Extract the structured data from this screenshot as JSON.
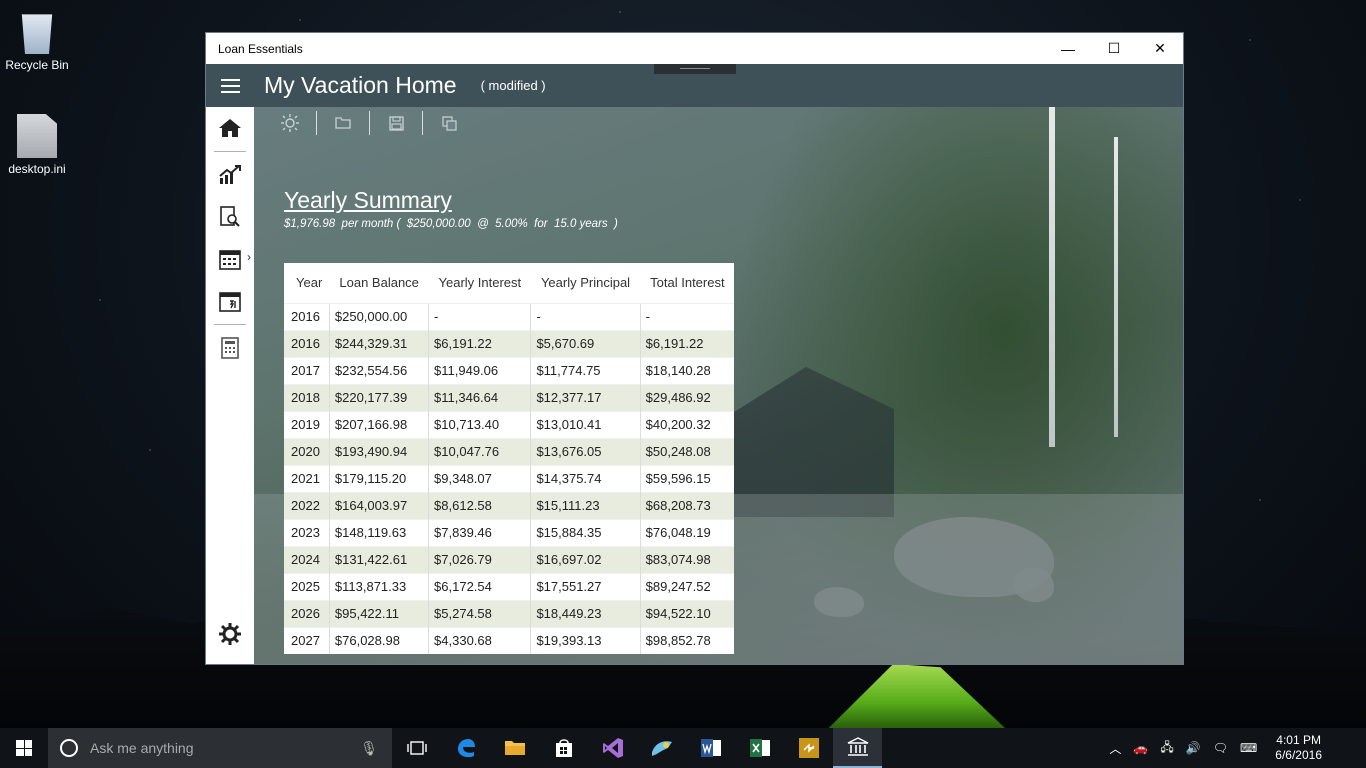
{
  "desktop": {
    "icons": [
      {
        "label": "Recycle Bin"
      },
      {
        "label": "desktop.ini"
      }
    ]
  },
  "window": {
    "title": "Loan Essentials",
    "controls": {
      "minimize": "—",
      "maximize": "☐",
      "close": "✕"
    }
  },
  "header": {
    "doc_title": "My Vacation Home",
    "modified": "( modified )"
  },
  "summary": {
    "title": "Yearly Summary",
    "subtitle": "$1,976.98  per month (  $250,000.00  @  5.00%  for  15.0 years  )"
  },
  "table": {
    "headers": [
      "Year",
      "Loan Balance",
      "Yearly Interest",
      "Yearly Principal",
      "Total Interest"
    ],
    "rows": [
      [
        "2016",
        "$250,000.00",
        "-",
        "-",
        "-"
      ],
      [
        "2016",
        "$244,329.31",
        "$6,191.22",
        "$5,670.69",
        "$6,191.22"
      ],
      [
        "2017",
        "$232,554.56",
        "$11,949.06",
        "$11,774.75",
        "$18,140.28"
      ],
      [
        "2018",
        "$220,177.39",
        "$11,346.64",
        "$12,377.17",
        "$29,486.92"
      ],
      [
        "2019",
        "$207,166.98",
        "$10,713.40",
        "$13,010.41",
        "$40,200.32"
      ],
      [
        "2020",
        "$193,490.94",
        "$10,047.76",
        "$13,676.05",
        "$50,248.08"
      ],
      [
        "2021",
        "$179,115.20",
        "$9,348.07",
        "$14,375.74",
        "$59,596.15"
      ],
      [
        "2022",
        "$164,003.97",
        "$8,612.58",
        "$15,111.23",
        "$68,208.73"
      ],
      [
        "2023",
        "$148,119.63",
        "$7,839.46",
        "$15,884.35",
        "$76,048.19"
      ],
      [
        "2024",
        "$131,422.61",
        "$7,026.79",
        "$16,697.02",
        "$83,074.98"
      ],
      [
        "2025",
        "$113,871.33",
        "$6,172.54",
        "$17,551.27",
        "$89,247.52"
      ],
      [
        "2026",
        "$95,422.11",
        "$5,274.58",
        "$18,449.23",
        "$94,522.10"
      ],
      [
        "2027",
        "$76,028.98",
        "$4,330.68",
        "$19,393.13",
        "$98,852.78"
      ]
    ]
  },
  "taskbar": {
    "search_placeholder": "Ask me anything",
    "time": "4:01 PM",
    "date": "6/6/2016"
  },
  "colors": {
    "header_bg": "#3f5158",
    "table_alt_row": "#e7ecdf"
  }
}
